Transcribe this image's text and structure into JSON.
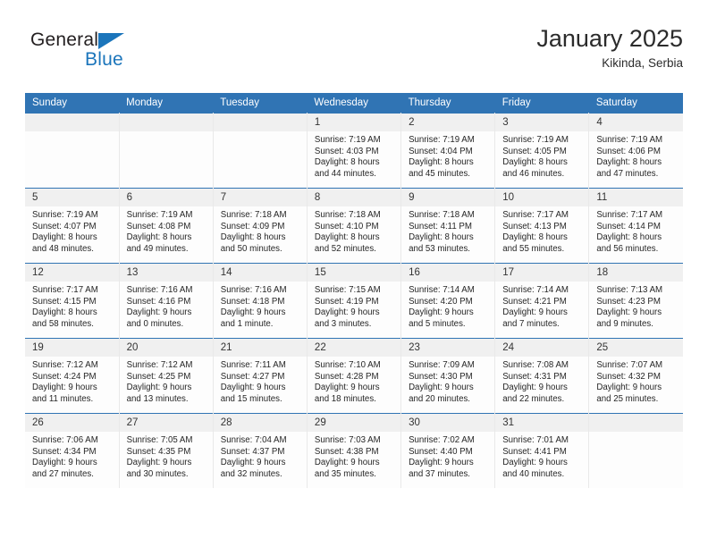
{
  "brand": {
    "name_top": "General",
    "name_bottom": "Blue",
    "accent_color": "#1b75bb"
  },
  "header": {
    "title": "January 2025",
    "subtitle": "Kikinda, Serbia"
  },
  "theme": {
    "header_row_bg": "#3074b4",
    "daynum_bg": "#f0f0f0",
    "cell_bg": "#fdfdfd",
    "text_color": "#262626"
  },
  "calendar": {
    "weekday_headers": [
      "Sunday",
      "Monday",
      "Tuesday",
      "Wednesday",
      "Thursday",
      "Friday",
      "Saturday"
    ],
    "labels": {
      "sunrise": "Sunrise:",
      "sunset": "Sunset:",
      "daylight": "Daylight:"
    },
    "weeks": [
      [
        {
          "day": "",
          "empty": true
        },
        {
          "day": "",
          "empty": true
        },
        {
          "day": "",
          "empty": true
        },
        {
          "day": "1",
          "sunrise": "Sunrise: 7:19 AM",
          "sunset": "Sunset: 4:03 PM",
          "daylight_1": "Daylight: 8 hours",
          "daylight_2": "and 44 minutes."
        },
        {
          "day": "2",
          "sunrise": "Sunrise: 7:19 AM",
          "sunset": "Sunset: 4:04 PM",
          "daylight_1": "Daylight: 8 hours",
          "daylight_2": "and 45 minutes."
        },
        {
          "day": "3",
          "sunrise": "Sunrise: 7:19 AM",
          "sunset": "Sunset: 4:05 PM",
          "daylight_1": "Daylight: 8 hours",
          "daylight_2": "and 46 minutes."
        },
        {
          "day": "4",
          "sunrise": "Sunrise: 7:19 AM",
          "sunset": "Sunset: 4:06 PM",
          "daylight_1": "Daylight: 8 hours",
          "daylight_2": "and 47 minutes."
        }
      ],
      [
        {
          "day": "5",
          "sunrise": "Sunrise: 7:19 AM",
          "sunset": "Sunset: 4:07 PM",
          "daylight_1": "Daylight: 8 hours",
          "daylight_2": "and 48 minutes."
        },
        {
          "day": "6",
          "sunrise": "Sunrise: 7:19 AM",
          "sunset": "Sunset: 4:08 PM",
          "daylight_1": "Daylight: 8 hours",
          "daylight_2": "and 49 minutes."
        },
        {
          "day": "7",
          "sunrise": "Sunrise: 7:18 AM",
          "sunset": "Sunset: 4:09 PM",
          "daylight_1": "Daylight: 8 hours",
          "daylight_2": "and 50 minutes."
        },
        {
          "day": "8",
          "sunrise": "Sunrise: 7:18 AM",
          "sunset": "Sunset: 4:10 PM",
          "daylight_1": "Daylight: 8 hours",
          "daylight_2": "and 52 minutes."
        },
        {
          "day": "9",
          "sunrise": "Sunrise: 7:18 AM",
          "sunset": "Sunset: 4:11 PM",
          "daylight_1": "Daylight: 8 hours",
          "daylight_2": "and 53 minutes."
        },
        {
          "day": "10",
          "sunrise": "Sunrise: 7:17 AM",
          "sunset": "Sunset: 4:13 PM",
          "daylight_1": "Daylight: 8 hours",
          "daylight_2": "and 55 minutes."
        },
        {
          "day": "11",
          "sunrise": "Sunrise: 7:17 AM",
          "sunset": "Sunset: 4:14 PM",
          "daylight_1": "Daylight: 8 hours",
          "daylight_2": "and 56 minutes."
        }
      ],
      [
        {
          "day": "12",
          "sunrise": "Sunrise: 7:17 AM",
          "sunset": "Sunset: 4:15 PM",
          "daylight_1": "Daylight: 8 hours",
          "daylight_2": "and 58 minutes."
        },
        {
          "day": "13",
          "sunrise": "Sunrise: 7:16 AM",
          "sunset": "Sunset: 4:16 PM",
          "daylight_1": "Daylight: 9 hours",
          "daylight_2": "and 0 minutes."
        },
        {
          "day": "14",
          "sunrise": "Sunrise: 7:16 AM",
          "sunset": "Sunset: 4:18 PM",
          "daylight_1": "Daylight: 9 hours",
          "daylight_2": "and 1 minute."
        },
        {
          "day": "15",
          "sunrise": "Sunrise: 7:15 AM",
          "sunset": "Sunset: 4:19 PM",
          "daylight_1": "Daylight: 9 hours",
          "daylight_2": "and 3 minutes."
        },
        {
          "day": "16",
          "sunrise": "Sunrise: 7:14 AM",
          "sunset": "Sunset: 4:20 PM",
          "daylight_1": "Daylight: 9 hours",
          "daylight_2": "and 5 minutes."
        },
        {
          "day": "17",
          "sunrise": "Sunrise: 7:14 AM",
          "sunset": "Sunset: 4:21 PM",
          "daylight_1": "Daylight: 9 hours",
          "daylight_2": "and 7 minutes."
        },
        {
          "day": "18",
          "sunrise": "Sunrise: 7:13 AM",
          "sunset": "Sunset: 4:23 PM",
          "daylight_1": "Daylight: 9 hours",
          "daylight_2": "and 9 minutes."
        }
      ],
      [
        {
          "day": "19",
          "sunrise": "Sunrise: 7:12 AM",
          "sunset": "Sunset: 4:24 PM",
          "daylight_1": "Daylight: 9 hours",
          "daylight_2": "and 11 minutes."
        },
        {
          "day": "20",
          "sunrise": "Sunrise: 7:12 AM",
          "sunset": "Sunset: 4:25 PM",
          "daylight_1": "Daylight: 9 hours",
          "daylight_2": "and 13 minutes."
        },
        {
          "day": "21",
          "sunrise": "Sunrise: 7:11 AM",
          "sunset": "Sunset: 4:27 PM",
          "daylight_1": "Daylight: 9 hours",
          "daylight_2": "and 15 minutes."
        },
        {
          "day": "22",
          "sunrise": "Sunrise: 7:10 AM",
          "sunset": "Sunset: 4:28 PM",
          "daylight_1": "Daylight: 9 hours",
          "daylight_2": "and 18 minutes."
        },
        {
          "day": "23",
          "sunrise": "Sunrise: 7:09 AM",
          "sunset": "Sunset: 4:30 PM",
          "daylight_1": "Daylight: 9 hours",
          "daylight_2": "and 20 minutes."
        },
        {
          "day": "24",
          "sunrise": "Sunrise: 7:08 AM",
          "sunset": "Sunset: 4:31 PM",
          "daylight_1": "Daylight: 9 hours",
          "daylight_2": "and 22 minutes."
        },
        {
          "day": "25",
          "sunrise": "Sunrise: 7:07 AM",
          "sunset": "Sunset: 4:32 PM",
          "daylight_1": "Daylight: 9 hours",
          "daylight_2": "and 25 minutes."
        }
      ],
      [
        {
          "day": "26",
          "sunrise": "Sunrise: 7:06 AM",
          "sunset": "Sunset: 4:34 PM",
          "daylight_1": "Daylight: 9 hours",
          "daylight_2": "and 27 minutes."
        },
        {
          "day": "27",
          "sunrise": "Sunrise: 7:05 AM",
          "sunset": "Sunset: 4:35 PM",
          "daylight_1": "Daylight: 9 hours",
          "daylight_2": "and 30 minutes."
        },
        {
          "day": "28",
          "sunrise": "Sunrise: 7:04 AM",
          "sunset": "Sunset: 4:37 PM",
          "daylight_1": "Daylight: 9 hours",
          "daylight_2": "and 32 minutes."
        },
        {
          "day": "29",
          "sunrise": "Sunrise: 7:03 AM",
          "sunset": "Sunset: 4:38 PM",
          "daylight_1": "Daylight: 9 hours",
          "daylight_2": "and 35 minutes."
        },
        {
          "day": "30",
          "sunrise": "Sunrise: 7:02 AM",
          "sunset": "Sunset: 4:40 PM",
          "daylight_1": "Daylight: 9 hours",
          "daylight_2": "and 37 minutes."
        },
        {
          "day": "31",
          "sunrise": "Sunrise: 7:01 AM",
          "sunset": "Sunset: 4:41 PM",
          "daylight_1": "Daylight: 9 hours",
          "daylight_2": "and 40 minutes."
        },
        {
          "day": "",
          "empty": true
        }
      ]
    ]
  }
}
